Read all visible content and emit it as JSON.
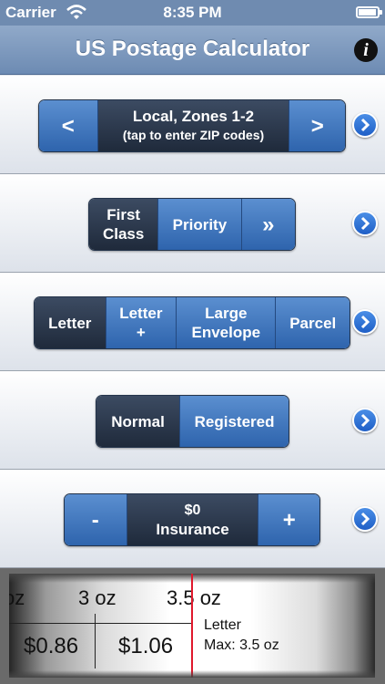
{
  "status_bar": {
    "carrier": "Carrier",
    "time": "8:35 PM"
  },
  "nav": {
    "title": "US Postage Calculator",
    "info_icon": "i"
  },
  "zone": {
    "prev": "<",
    "line1": "Local, Zones 1-2",
    "line2": "(tap to enter ZIP codes)",
    "next": ">"
  },
  "mail_class": {
    "first_class_line1": "First",
    "first_class_line2": "Class",
    "priority": "Priority",
    "more": "»"
  },
  "shape": {
    "letter": "Letter",
    "letter_plus_line1": "Letter",
    "letter_plus_line2": "+",
    "large_envelope_line1": "Large",
    "large_envelope_line2": "Envelope",
    "parcel": "Parcel"
  },
  "service": {
    "normal": "Normal",
    "registered": "Registered"
  },
  "insurance": {
    "minus": "-",
    "amount": "$0",
    "label": "Insurance",
    "plus": "+"
  },
  "scale": {
    "tick_partial": "oz",
    "tick_3": "3 oz",
    "tick_3_5": "3.5 oz",
    "price_1": "$0.86",
    "price_2": "$1.06",
    "type": "Letter",
    "max": "Max: 3.5 oz"
  },
  "colors": {
    "segment_selected": "#2a3a52",
    "segment_unselected": "#3d74bd",
    "indicator": "#e0182c"
  }
}
